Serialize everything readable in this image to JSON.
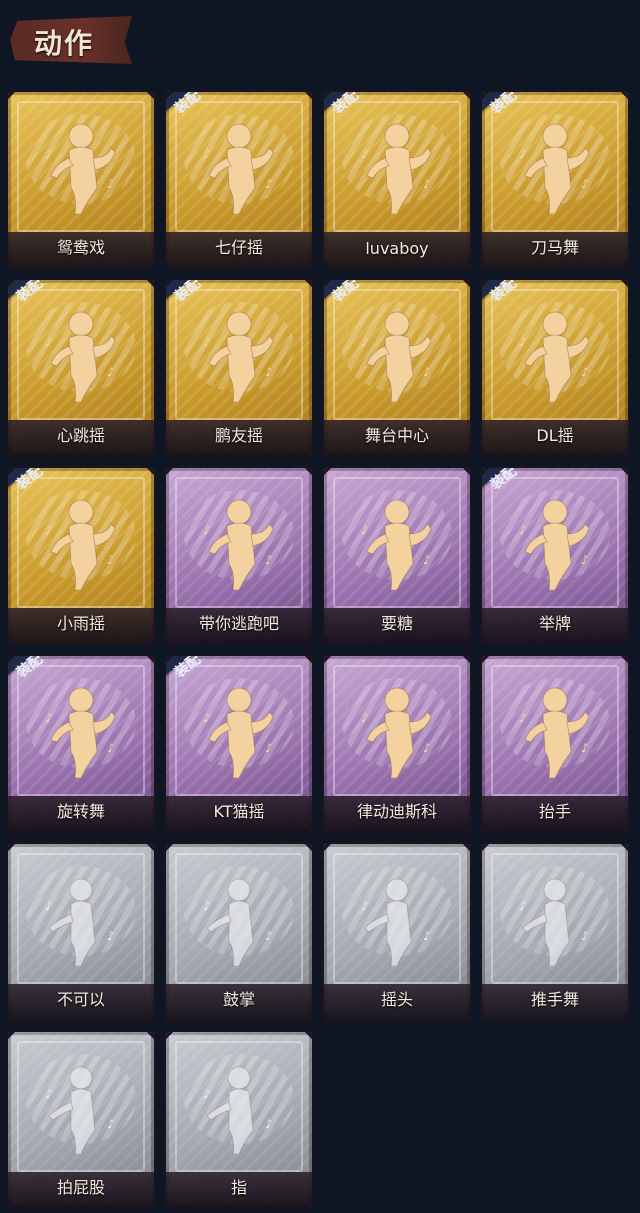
{
  "header": {
    "title": "动作"
  },
  "equip_label": "装配",
  "colors": {
    "gold": "#d6ad3e",
    "purple": "#9c74b0",
    "grey": "#a3a7af",
    "background": "#0e1624"
  },
  "cards": [
    {
      "label": "鸳鸯戏",
      "rarity": "gold",
      "equipped": false
    },
    {
      "label": "七仔摇",
      "rarity": "gold",
      "equipped": true
    },
    {
      "label": "luvaboy",
      "rarity": "gold",
      "equipped": true
    },
    {
      "label": "刀马舞",
      "rarity": "gold",
      "equipped": true
    },
    {
      "label": "心跳摇",
      "rarity": "gold",
      "equipped": true
    },
    {
      "label": "鹏友摇",
      "rarity": "gold",
      "equipped": true
    },
    {
      "label": "舞台中心",
      "rarity": "gold",
      "equipped": true
    },
    {
      "label": "DL摇",
      "rarity": "gold",
      "equipped": true
    },
    {
      "label": "小雨摇",
      "rarity": "gold",
      "equipped": true
    },
    {
      "label": "带你逃跑吧",
      "rarity": "purple",
      "equipped": false
    },
    {
      "label": "要糖",
      "rarity": "purple",
      "equipped": false
    },
    {
      "label": "举牌",
      "rarity": "purple",
      "equipped": true
    },
    {
      "label": "旋转舞",
      "rarity": "purple",
      "equipped": true
    },
    {
      "label": "KT猫摇",
      "rarity": "purple",
      "equipped": true
    },
    {
      "label": "律动迪斯科",
      "rarity": "purple",
      "equipped": false
    },
    {
      "label": "抬手",
      "rarity": "purple",
      "equipped": false
    },
    {
      "label": "不可以",
      "rarity": "grey",
      "equipped": false
    },
    {
      "label": "鼓掌",
      "rarity": "grey",
      "equipped": false
    },
    {
      "label": "摇头",
      "rarity": "grey",
      "equipped": false
    },
    {
      "label": "推手舞",
      "rarity": "grey",
      "equipped": false
    },
    {
      "label": "拍屁股",
      "rarity": "grey",
      "equipped": false
    },
    {
      "label": "指",
      "rarity": "grey",
      "equipped": false
    }
  ]
}
